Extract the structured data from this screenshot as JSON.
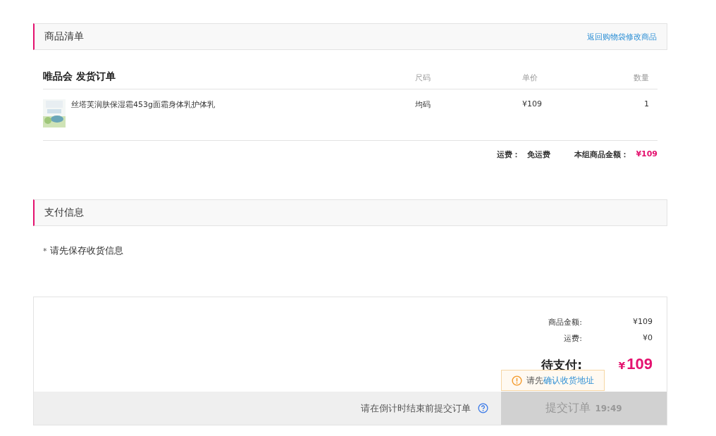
{
  "goods_section": {
    "title": "商品清单",
    "back_link": "返回购物袋修改商品"
  },
  "order_group": {
    "title": "唯品会 发货订单",
    "columns": [
      "尺码",
      "单价",
      "数量"
    ],
    "items": [
      {
        "name": "丝塔芙润肤保湿霜453g面霜身体乳护体乳",
        "size": "均码",
        "price": "¥109",
        "quantity": "1"
      }
    ],
    "shipping_label": "运费：",
    "shipping_value": "免运费",
    "subtotal_label": "本组商品金额：",
    "subtotal_value": "¥109"
  },
  "payment_section": {
    "title": "支付信息",
    "notice_mark": "*",
    "notice": "请先保存收货信息"
  },
  "summary": {
    "rows": [
      {
        "label": "商品金额:",
        "value": "¥109"
      },
      {
        "label": "运费:",
        "value": "¥0"
      }
    ],
    "due_label": "待支付:",
    "due_currency": "¥",
    "due_amount": "109",
    "tooltip": {
      "text": "请先",
      "link": "确认收货地址"
    },
    "countdown_hint": "请在倒计时结束前提交订单",
    "submit": {
      "label": "提交订单",
      "timer": "19:49",
      "disabled": true
    }
  }
}
